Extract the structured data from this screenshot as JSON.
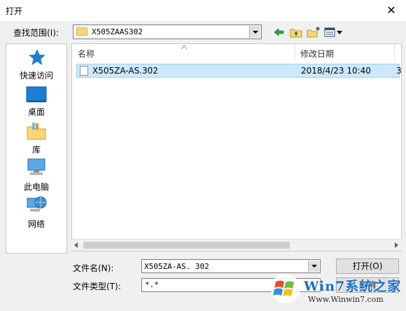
{
  "window": {
    "title": "打开",
    "close_glyph": "✕"
  },
  "look_in": {
    "label": "查找范围(I):",
    "value": "X505ZAAS302"
  },
  "sidebar": {
    "items": [
      {
        "label": "快速访问",
        "icon": "quick-access-star-icon"
      },
      {
        "label": "桌面",
        "icon": "desktop-icon"
      },
      {
        "label": "库",
        "icon": "library-icon"
      },
      {
        "label": "此电脑",
        "icon": "computer-icon"
      },
      {
        "label": "网络",
        "icon": "network-icon"
      }
    ]
  },
  "file_list": {
    "columns": [
      "名称",
      "修改日期"
    ],
    "rows": [
      {
        "name": "X505ZA-AS.302",
        "modified": "2018/4/23 10:40",
        "overflow": "3"
      }
    ]
  },
  "file_name": {
    "label": "文件名(N):",
    "value": "X505ZA-AS. 302"
  },
  "file_type": {
    "label": "文件类型(T):",
    "value": "*.*"
  },
  "buttons": {
    "open": "打开(O)",
    "cancel": "取消"
  },
  "watermark": {
    "brand": "Win7系统之家",
    "url": "Www.Winwin7.com"
  },
  "colors": {
    "selection": "#cce8ff",
    "selection_border": "#99d1ff",
    "toolbar_arrow": "#2f9f3a",
    "folder": "#f8d775",
    "accent_blue": "#1b7fd4"
  }
}
